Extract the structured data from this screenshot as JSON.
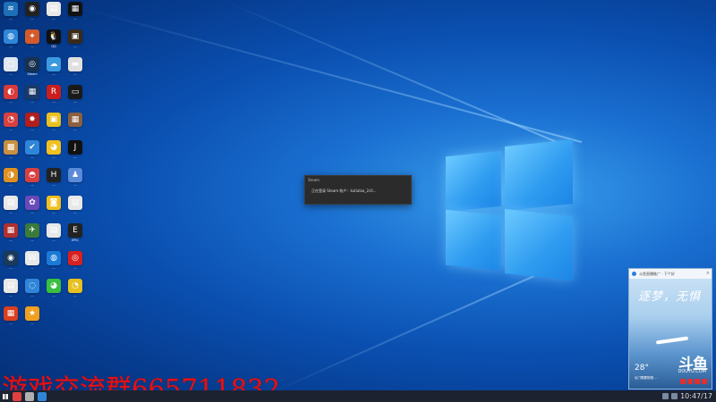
{
  "desktop": {
    "icons": [
      {
        "label": "...",
        "color": "#1e6fb8",
        "glyph": "≋"
      },
      {
        "label": "...",
        "color": "#222222",
        "glyph": "◉"
      },
      {
        "label": "...",
        "color": "#e8e8e8",
        "glyph": "▤"
      },
      {
        "label": "...",
        "color": "#111111",
        "glyph": "▦"
      },
      {
        "label": "...",
        "color": "#2f86d8",
        "glyph": "◍"
      },
      {
        "label": "...",
        "color": "#d45a2a",
        "glyph": "✦"
      },
      {
        "label": "QQ",
        "color": "#111111",
        "glyph": "🐧"
      },
      {
        "label": "...",
        "color": "#3a2a1a",
        "glyph": "▣"
      },
      {
        "label": "...",
        "color": "#dfe8f0",
        "glyph": "▢"
      },
      {
        "label": "Steam",
        "color": "#17324f",
        "glyph": "◎"
      },
      {
        "label": "...",
        "color": "#3a9ae0",
        "glyph": "☁"
      },
      {
        "label": "...",
        "color": "#e0e0e0",
        "glyph": "▬"
      },
      {
        "label": "...",
        "color": "#d83a3a",
        "glyph": "◐"
      },
      {
        "label": "...",
        "color": "#1a3a6a",
        "glyph": "▦"
      },
      {
        "label": "...",
        "color": "#c81e1e",
        "glyph": "R"
      },
      {
        "label": "...",
        "color": "#1a1a1a",
        "glyph": "▭"
      },
      {
        "label": "...",
        "color": "#d84040",
        "glyph": "◔"
      },
      {
        "label": "...",
        "color": "#b01e1e",
        "glyph": "✸"
      },
      {
        "label": "...",
        "color": "#e8c020",
        "glyph": "▣"
      },
      {
        "label": "...",
        "color": "#8a6040",
        "glyph": "▦"
      },
      {
        "label": "...",
        "color": "#c89040",
        "glyph": "▩"
      },
      {
        "label": "...",
        "color": "#2f86d8",
        "glyph": "✔"
      },
      {
        "label": "...",
        "color": "#f0c020",
        "glyph": "◕"
      },
      {
        "label": "...",
        "color": "#111111",
        "glyph": "J"
      },
      {
        "label": "...",
        "color": "#e09020",
        "glyph": "◑"
      },
      {
        "label": "...",
        "color": "#d84040",
        "glyph": "◓"
      },
      {
        "label": "...",
        "color": "#222222",
        "glyph": "H"
      },
      {
        "label": "...",
        "color": "#5a8ad8",
        "glyph": "♟"
      },
      {
        "label": "...",
        "color": "#e8e8e8",
        "glyph": "▤"
      },
      {
        "label": "...",
        "color": "#6a4ab8",
        "glyph": "✿"
      },
      {
        "label": "...",
        "color": "#f0c020",
        "glyph": "◙"
      },
      {
        "label": "...",
        "color": "#e8e8e8",
        "glyph": "▤"
      },
      {
        "label": "...",
        "color": "#b03030",
        "glyph": "▦"
      },
      {
        "label": "...",
        "color": "#3a7a3a",
        "glyph": "✈"
      },
      {
        "label": "...",
        "color": "#e8e8e8",
        "glyph": "▤"
      },
      {
        "label": "EPIC",
        "color": "#222222",
        "glyph": "E"
      },
      {
        "label": "...",
        "color": "#1a3a5a",
        "glyph": "◉"
      },
      {
        "label": "...",
        "color": "#e8e8e8",
        "glyph": "W"
      },
      {
        "label": "...",
        "color": "#1a7ad8",
        "glyph": "◍"
      },
      {
        "label": "...",
        "color": "#d82020",
        "glyph": "◎"
      },
      {
        "label": "...",
        "color": "#e8e8e8",
        "glyph": "▤"
      },
      {
        "label": "...",
        "color": "#2f86d8",
        "glyph": "◌"
      },
      {
        "label": "...",
        "color": "#3ac040",
        "glyph": "◕"
      },
      {
        "label": "...",
        "color": "#e8c020",
        "glyph": "◔"
      },
      {
        "label": "...",
        "color": "#d84020",
        "glyph": "▦"
      },
      {
        "label": "...",
        "color": "#f0a020",
        "glyph": "★"
      }
    ]
  },
  "toast": {
    "title": "Steam",
    "message": "正在登录 Steam 帐户：kutialaa_2c0..."
  },
  "ad": {
    "header": "斗鱼直播推广 · 下个好",
    "close": "×",
    "slogan": "逐梦，无惧",
    "temperature": "28°",
    "brand": "斗鱼",
    "brand_sub": "DOUYU.COM",
    "caption": "出门需要防晒 …"
  },
  "overlay": {
    "text": "游戏交流群665711832"
  },
  "taskbar": {
    "clock": "10:47/17",
    "pinned": [
      {
        "name": "pinned-app-1",
        "color": "#e04040"
      },
      {
        "name": "pinned-app-2",
        "color": "#b0b0b0"
      },
      {
        "name": "pinned-app-3",
        "color": "#2f86d8"
      }
    ]
  }
}
